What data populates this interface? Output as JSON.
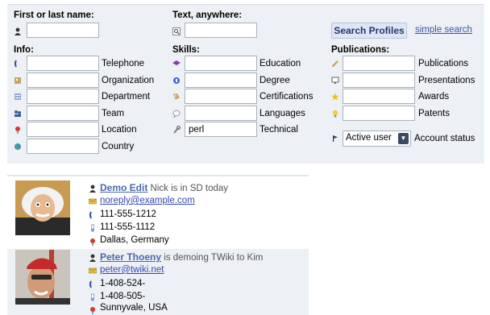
{
  "search": {
    "name_label": "First or last name:",
    "name_value": "",
    "text_label": "Text, anywhere:",
    "text_value": "",
    "search_button": "Search Profiles",
    "simple_link": "simple search"
  },
  "info": {
    "heading": "Info:",
    "fields": [
      {
        "label": "Telephone",
        "value": "",
        "icon": "phone-icon"
      },
      {
        "label": "Organization",
        "value": "",
        "icon": "organization-icon"
      },
      {
        "label": "Department",
        "value": "",
        "icon": "department-icon"
      },
      {
        "label": "Team",
        "value": "",
        "icon": "team-icon"
      },
      {
        "label": "Location",
        "value": "",
        "icon": "location-pin-icon"
      },
      {
        "label": "Country",
        "value": "",
        "icon": "globe-icon"
      }
    ]
  },
  "skills": {
    "heading": "Skills:",
    "fields": [
      {
        "label": "Education",
        "value": "",
        "icon": "graduation-cap-icon"
      },
      {
        "label": "Degree",
        "value": "",
        "icon": "degree-icon"
      },
      {
        "label": "Certifications",
        "value": "",
        "icon": "certification-icon"
      },
      {
        "label": "Languages",
        "value": "",
        "icon": "speech-bubble-icon"
      },
      {
        "label": "Technical",
        "value": "perl",
        "icon": "wrench-icon"
      }
    ]
  },
  "publications": {
    "heading": "Publications:",
    "fields": [
      {
        "label": "Publications",
        "value": "",
        "icon": "pencil-icon"
      },
      {
        "label": "Presentations",
        "value": "",
        "icon": "monitor-icon"
      },
      {
        "label": "Awards",
        "value": "",
        "icon": "star-icon"
      },
      {
        "label": "Patents",
        "value": "",
        "icon": "lightbulb-icon"
      }
    ],
    "account_label": "Account status",
    "account_value": "Active user"
  },
  "results": [
    {
      "name": "Demo Edit",
      "status": "Nick is in SD today",
      "email": "noreply@example.com",
      "phone": "111-555-1212",
      "mobile": "111-555-1112",
      "location": "Dallas, Germany"
    },
    {
      "name": "Peter Thoeny",
      "status": "is demoing TWiki to Kim",
      "email": "peter@twiki.net",
      "phone": "1-408-524-",
      "mobile": "1-408-505-",
      "location": "Sunnyvale, USA"
    }
  ],
  "colors": {
    "panel_bg": "#edf0f4",
    "link": "#3a57a8",
    "button_bg": "#dfe6f3"
  }
}
